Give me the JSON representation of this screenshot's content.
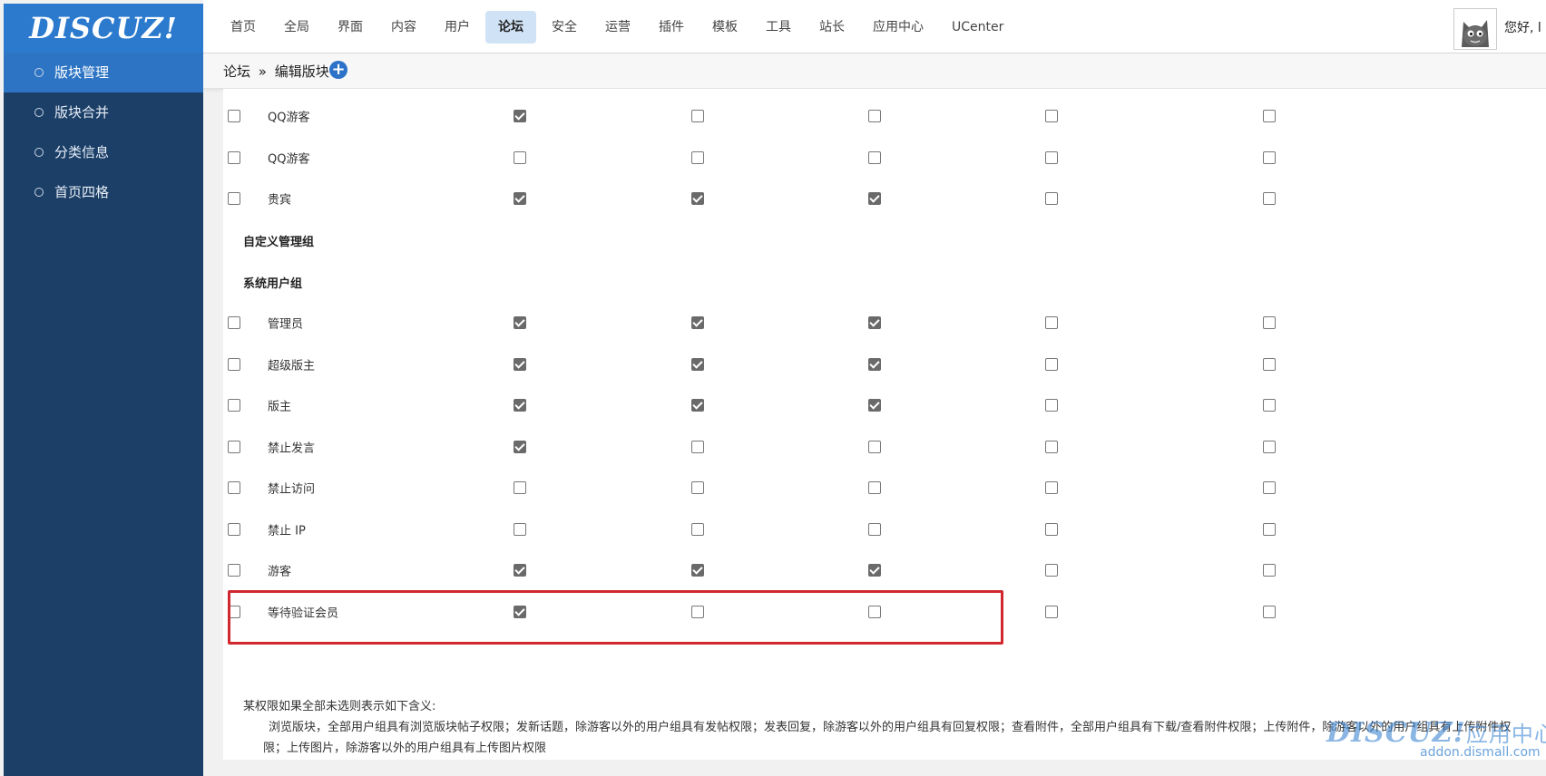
{
  "app": {
    "logo": "DISCUZ!"
  },
  "header": {
    "nav": [
      "首页",
      "全局",
      "界面",
      "内容",
      "用户",
      "论坛",
      "安全",
      "运营",
      "插件",
      "模板",
      "工具",
      "站长",
      "应用中心",
      "UCenter"
    ],
    "active_nav": "论坛",
    "greeting": "您好, l"
  },
  "sidebar": {
    "items": [
      {
        "label": "版块管理",
        "active": true
      },
      {
        "label": "版块合并",
        "active": false
      },
      {
        "label": "分类信息",
        "active": false
      },
      {
        "label": "首页四格",
        "active": false
      }
    ]
  },
  "breadcrumb": {
    "root": "论坛",
    "sep": "»",
    "current": "编辑版块",
    "add_label": "+"
  },
  "sections": {
    "custom_admin": "自定义管理组",
    "system_groups": "系统用户组"
  },
  "permission_rows": [
    {
      "name": "QQ游客",
      "checks": [
        true,
        false,
        false,
        false,
        false
      ]
    },
    {
      "name": "QQ游客",
      "checks": [
        false,
        false,
        false,
        false,
        false
      ]
    },
    {
      "name": "贵宾",
      "checks": [
        true,
        true,
        true,
        false,
        false
      ]
    },
    {
      "name": "管理员",
      "checks": [
        true,
        true,
        true,
        false,
        false
      ]
    },
    {
      "name": "超级版主",
      "checks": [
        true,
        true,
        true,
        false,
        false
      ]
    },
    {
      "name": "版主",
      "checks": [
        true,
        true,
        true,
        false,
        false
      ]
    },
    {
      "name": "禁止发言",
      "checks": [
        true,
        false,
        false,
        false,
        false
      ]
    },
    {
      "name": "禁止访问",
      "checks": [
        false,
        false,
        false,
        false,
        false
      ]
    },
    {
      "name": "禁止 IP",
      "checks": [
        false,
        false,
        false,
        false,
        false
      ]
    },
    {
      "name": "游客",
      "checks": [
        true,
        true,
        true,
        false,
        false
      ]
    },
    {
      "name": "等待验证会员",
      "checks": [
        true,
        false,
        false,
        false,
        false
      ]
    }
  ],
  "note": {
    "title": "某权限如果全部未选则表示如下含义:",
    "line1": "浏览版块，全部用户组具有浏览版块帖子权限；发新话题，除游客以外的用户组具有发帖权限；发表回复，除游客以外的用户组具有回复权限；查看附件，全部用户组具有下载/查看附件权限；上传附件，除游客以外的用户组具有上传附件权",
    "line2": "限；上传图片，除游客以外的用户组具有上传图片权限"
  },
  "watermark": {
    "logo": "DISCUZ!",
    "suffix": "应用中心",
    "url": "addon.dismall.com"
  },
  "colors": {
    "brand": "#2b7acd",
    "sidebar": "#1c3f67",
    "highlight": "#d0282e"
  }
}
